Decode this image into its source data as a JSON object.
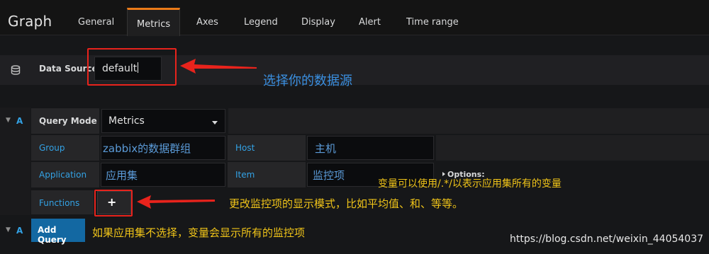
{
  "panel": {
    "title": "Graph",
    "tabs": [
      "General",
      "Metrics",
      "Axes",
      "Legend",
      "Display",
      "Alert",
      "Time range"
    ],
    "active_tab": "Metrics"
  },
  "data_source": {
    "label": "Data Source",
    "value": "default",
    "icon": "database-icon"
  },
  "query": {
    "letter": "A",
    "mode_label": "Query Mode",
    "mode_value": "Metrics",
    "group_label": "Group",
    "group_value": "zabbix的数据群组",
    "host_label": "Host",
    "host_value": "主机",
    "application_label": "Application",
    "application_value": "应用集",
    "item_label": "Item",
    "item_value": "监控项",
    "functions_label": "Functions",
    "add_function": "+",
    "options_label": "Options:"
  },
  "add_query": {
    "letter": "A",
    "label": "Add Query"
  },
  "annotations": {
    "datasource_note": "选择你的数据源",
    "variable_note": "变量可以使用/.*/以表示应用集所有的变量",
    "functions_note": "更改监控项的显示模式，比如平均值、和、等等。",
    "addquery_note": "如果应用集不选择，变量会显示所有的监控项"
  },
  "watermark": "https://blog.csdn.net/weixin_44054037",
  "colors": {
    "accent_tab": "#eb7b18",
    "label_blue": "#33a2e5",
    "add_query_button": "#1368a2",
    "annotation_red": "#e8231c",
    "annotation_blue": "#3a8fe0",
    "annotation_yellow": "#f0c419"
  }
}
